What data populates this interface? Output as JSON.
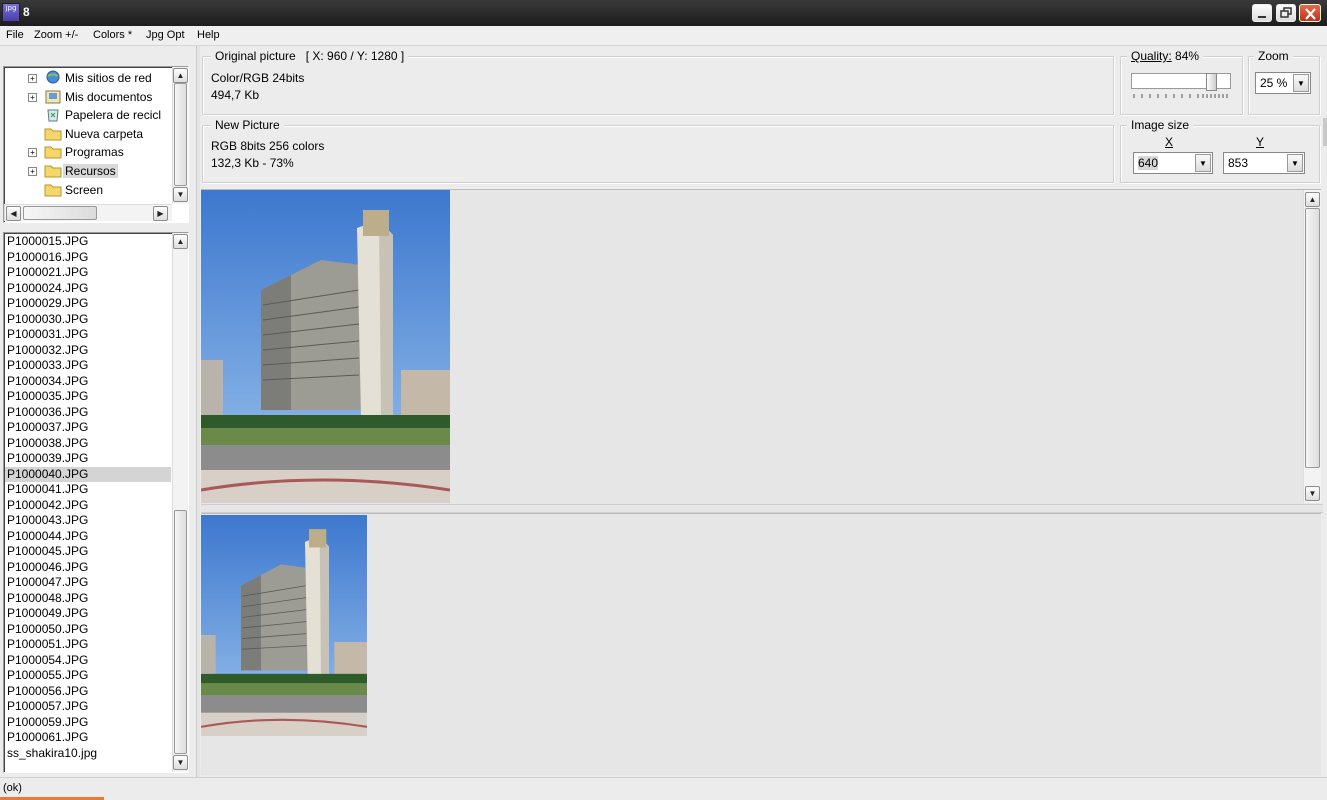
{
  "window": {
    "title": "8",
    "app_icon_text": "jpg"
  },
  "menu": [
    "File",
    "Zoom +/-",
    "Colors *",
    "Jpg Opt",
    "Help"
  ],
  "tree": [
    {
      "label": "Mis sitios de red",
      "icon": "network-icon",
      "expandable": true
    },
    {
      "label": "Mis documentos",
      "icon": "documents-icon",
      "expandable": true
    },
    {
      "label": "Papelera de recicl",
      "icon": "recycle-bin-icon",
      "expandable": false
    },
    {
      "label": "Nueva carpeta",
      "icon": "folder-icon",
      "expandable": false
    },
    {
      "label": "Programas",
      "icon": "folder-icon",
      "expandable": true
    },
    {
      "label": "Recursos",
      "icon": "folder-icon",
      "expandable": true,
      "selected": true
    },
    {
      "label": "Screen",
      "icon": "folder-icon",
      "expandable": false
    }
  ],
  "files": [
    "P1000015.JPG",
    "P1000016.JPG",
    "P1000021.JPG",
    "P1000024.JPG",
    "P1000029.JPG",
    "P1000030.JPG",
    "P1000031.JPG",
    "P1000032.JPG",
    "P1000033.JPG",
    "P1000034.JPG",
    "P1000035.JPG",
    "P1000036.JPG",
    "P1000037.JPG",
    "P1000038.JPG",
    "P1000039.JPG",
    "P1000040.JPG",
    "P1000041.JPG",
    "P1000042.JPG",
    "P1000043.JPG",
    "P1000044.JPG",
    "P1000045.JPG",
    "P1000046.JPG",
    "P1000047.JPG",
    "P1000048.JPG",
    "P1000049.JPG",
    "P1000050.JPG",
    "P1000051.JPG",
    "P1000054.JPG",
    "P1000055.JPG",
    "P1000056.JPG",
    "P1000057.JPG",
    "P1000059.JPG",
    "P1000061.JPG",
    "ss_shakira10.jpg"
  ],
  "selected_file": "P1000040.JPG",
  "original": {
    "title": "Original picture",
    "dims": "[ X: 960 / Y: 1280 ]",
    "color": "Color/RGB 24bits",
    "size": "494,7 Kb"
  },
  "newpic": {
    "title": "New Picture",
    "color": "RGB 8bits 256 colors",
    "size": "132,3 Kb  - 73%"
  },
  "quality": {
    "label": "Quality:",
    "value": "84%",
    "level": 0.84
  },
  "zoom": {
    "label": "Zoom",
    "value": "25 %"
  },
  "image_size": {
    "label": "Image size",
    "x_label": "X",
    "y_label": "Y",
    "x_value": "640",
    "y_value": "853"
  },
  "status": "(ok)",
  "colors": {
    "sky": "#4b86d6",
    "building": "#a9a9a0",
    "tower": "#e4e0d8"
  }
}
